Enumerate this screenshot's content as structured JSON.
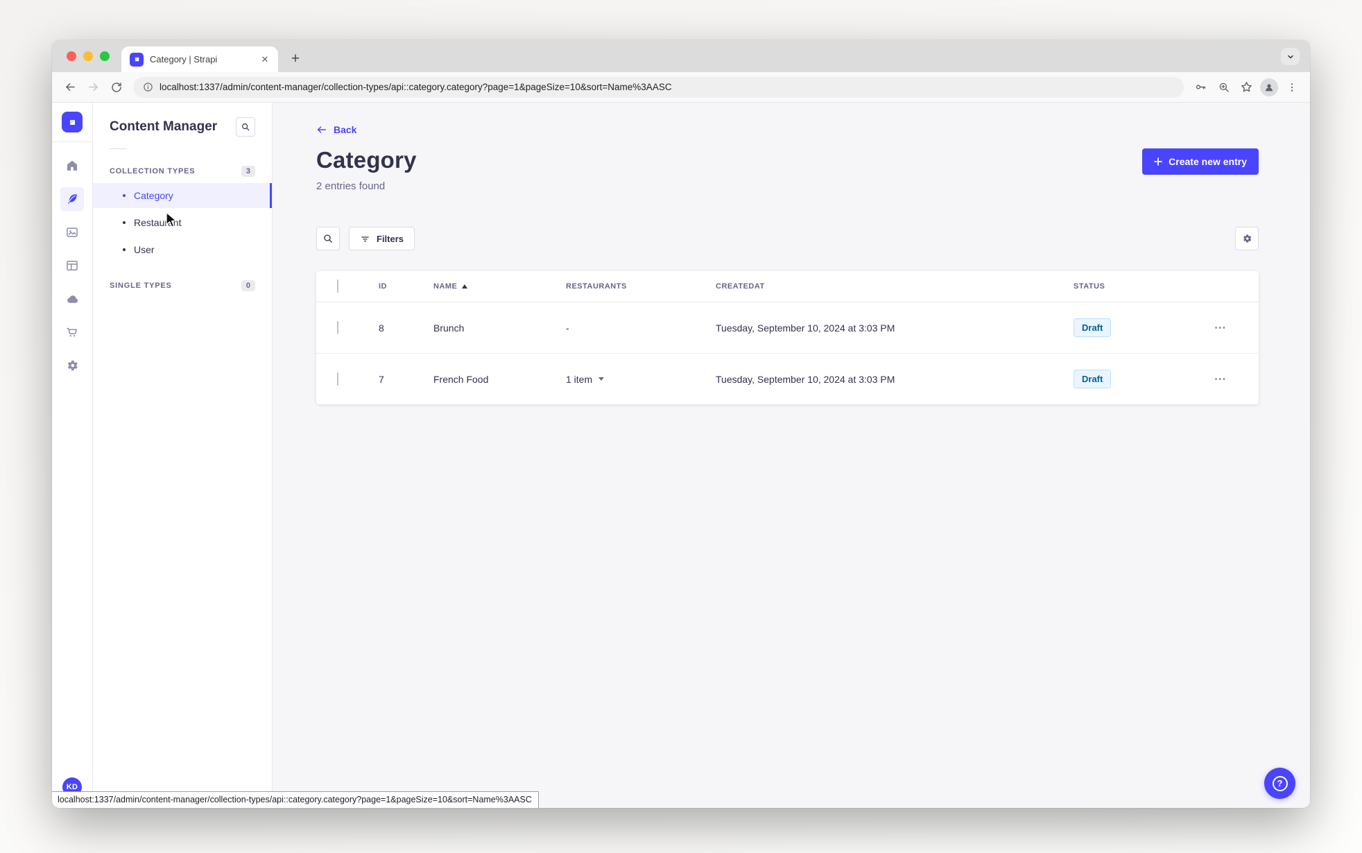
{
  "browser": {
    "tab_title": "Category | Strapi",
    "new_tab_label": "+",
    "close_tab_label": "✕",
    "url": "localhost:1337/admin/content-manager/collection-types/api::category.category?page=1&pageSize=10&sort=Name%3AASC",
    "status_bar_url": "localhost:1337/admin/content-manager/collection-types/api::category.category?page=1&pageSize=10&sort=Name%3AASC"
  },
  "subnav": {
    "title": "Content Manager",
    "collection_types": {
      "label": "COLLECTION TYPES",
      "count": "3"
    },
    "single_types": {
      "label": "SINGLE TYPES",
      "count": "0"
    },
    "items": [
      {
        "label": "Category"
      },
      {
        "label": "Restaurant"
      },
      {
        "label": "User"
      }
    ],
    "avatar_initials": "KD"
  },
  "main": {
    "back_label": "Back",
    "title": "Category",
    "subtitle": "2 entries found",
    "create_button_label": "Create new entry",
    "filters_button_label": "Filters",
    "table": {
      "headers": [
        "ID",
        "NAME",
        "RESTAURANTS",
        "CREATEDAT",
        "STATUS"
      ],
      "rows": [
        {
          "id": "8",
          "name": "Brunch",
          "restaurants": "-",
          "created_at": "Tuesday, September 10, 2024 at 3:03 PM",
          "status": "Draft"
        },
        {
          "id": "7",
          "name": "French Food",
          "restaurants": "1 item",
          "created_at": "Tuesday, September 10, 2024 at 3:03 PM",
          "status": "Draft"
        }
      ],
      "row_actions_label": "⋯"
    }
  },
  "colors": {
    "accent": "#4945FF",
    "accent_bg": "#F0F0FF",
    "draft_bg": "#EAF5FF",
    "draft_border": "#B8E1FF",
    "draft_text": "#006096"
  }
}
